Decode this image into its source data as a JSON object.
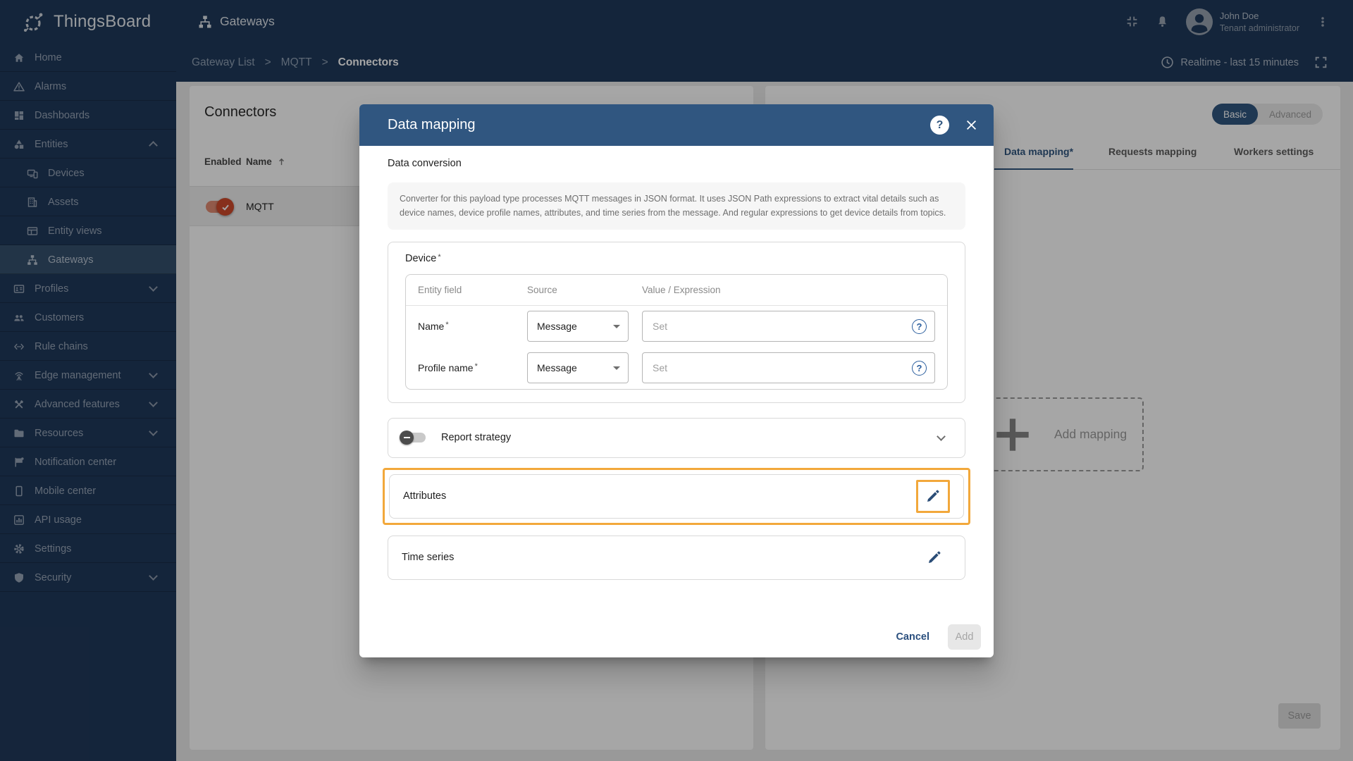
{
  "brand": {
    "name": "ThingsBoard"
  },
  "topbar": {
    "module_title": "Gateways",
    "user": {
      "name": "John Doe",
      "role": "Tenant administrator"
    }
  },
  "breadcrumb": {
    "items": [
      "Gateway List",
      "MQTT",
      "Connectors"
    ],
    "separator": ">"
  },
  "timewindow": {
    "label": "Realtime - last 15 minutes"
  },
  "sidebar": {
    "items": [
      {
        "label": "Home",
        "icon": "home"
      },
      {
        "label": "Alarms",
        "icon": "alarms"
      },
      {
        "label": "Dashboards",
        "icon": "dashboards"
      },
      {
        "label": "Entities",
        "icon": "entities",
        "expanded": true
      },
      {
        "label": "Devices",
        "icon": "devices",
        "child": true
      },
      {
        "label": "Assets",
        "icon": "assets",
        "child": true
      },
      {
        "label": "Entity views",
        "icon": "entity-views",
        "child": true
      },
      {
        "label": "Gateways",
        "icon": "gateways",
        "child": true,
        "active": true
      },
      {
        "label": "Profiles",
        "icon": "profiles",
        "collapsible": true
      },
      {
        "label": "Customers",
        "icon": "customers"
      },
      {
        "label": "Rule chains",
        "icon": "rule-chains"
      },
      {
        "label": "Edge management",
        "icon": "edge-management",
        "collapsible": true
      },
      {
        "label": "Advanced features",
        "icon": "advanced-features",
        "collapsible": true
      },
      {
        "label": "Resources",
        "icon": "resources",
        "collapsible": true
      },
      {
        "label": "Notification center",
        "icon": "notification-center"
      },
      {
        "label": "Mobile center",
        "icon": "mobile-center"
      },
      {
        "label": "API usage",
        "icon": "api-usage"
      },
      {
        "label": "Settings",
        "icon": "settings"
      },
      {
        "label": "Security",
        "icon": "security",
        "collapsible": true
      }
    ]
  },
  "connectors_panel": {
    "title": "Connectors",
    "columns": [
      "Enabled",
      "Name"
    ],
    "rows": [
      {
        "name": "MQTT",
        "enabled": true
      }
    ]
  },
  "right_panel": {
    "mode_toggle": {
      "options": [
        "Basic",
        "Advanced"
      ],
      "selected": "Basic"
    },
    "tabs": [
      {
        "label": "Data mapping*",
        "active": true
      },
      {
        "label": "Requests mapping",
        "active": false
      },
      {
        "label": "Workers settings",
        "active": false
      }
    ],
    "add_mapping_label": "Add mapping",
    "save_label": "Save"
  },
  "modal": {
    "title": "Data mapping",
    "data_conversion": {
      "title": "Data conversion",
      "description": "Converter for this payload type processes MQTT messages in JSON format. It uses JSON Path expressions to extract vital details such as device names, device profile names, attributes, and time series from the message. And regular expressions to get device details from topics."
    },
    "device": {
      "title": "Device",
      "required_marker": "*",
      "columns": [
        "Entity field",
        "Source",
        "Value / Expression"
      ],
      "rows": [
        {
          "field": "Name",
          "required": true,
          "source": "Message",
          "value_placeholder": "Set"
        },
        {
          "field": "Profile name",
          "required": true,
          "source": "Message",
          "value_placeholder": "Set"
        }
      ]
    },
    "report_strategy": {
      "label": "Report strategy",
      "enabled": false
    },
    "attributes": {
      "label": "Attributes",
      "highlighted": true
    },
    "time_series": {
      "label": "Time series"
    },
    "footer": {
      "cancel_label": "Cancel",
      "add_label": "Add",
      "add_enabled": false
    }
  },
  "icons": {
    "question": "?"
  },
  "colors": {
    "primary": "#305680",
    "sidebar_bg": "#20395b",
    "accent_toggle": "#d04a2b",
    "highlight_orange": "#f2a83b",
    "tab_active": "#305680"
  }
}
